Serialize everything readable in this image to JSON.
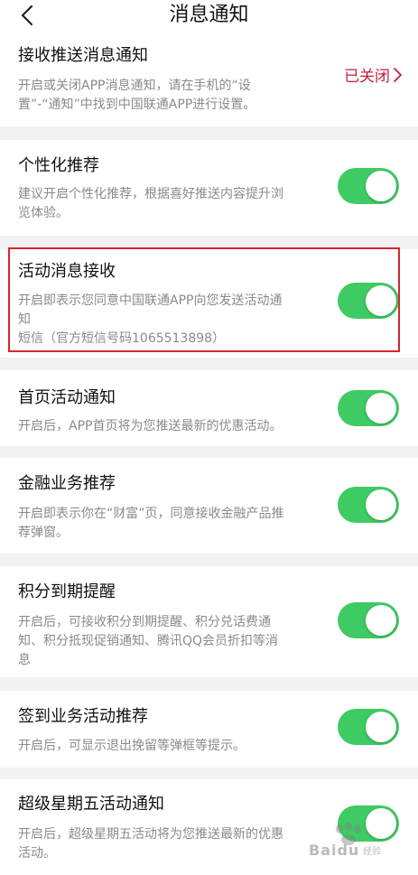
{
  "header": {
    "title": "消息通知"
  },
  "sections": [
    {
      "title": "接收推送消息通知",
      "desc": [
        "开启或关闭APP消息通知，请在手机的“设",
        "置”-“通知”中找到中国联通APP进行设置。"
      ],
      "status": "已关闭"
    },
    {
      "title": "个性化推荐",
      "desc": [
        "建议开启个性化推荐，根据喜好推送内容提升浏",
        "览体验。"
      ],
      "enabled": true
    },
    {
      "title": "活动消息接收",
      "desc": [
        "开启即表示您同意中国联通APP向您发送活动通",
        "知",
        "短信（官方短信号码1065513898）"
      ],
      "enabled": true
    },
    {
      "title": "首页活动通知",
      "desc": [
        "开启后，APP首页将为您推送最新的优惠活动。"
      ],
      "enabled": true
    },
    {
      "title": "金融业务推荐",
      "desc": [
        "开启即表示你在“财富”页，同意接收金融产品推",
        "荐弹窗。"
      ],
      "enabled": true
    },
    {
      "title": "积分到期提醒",
      "desc": [
        "开启后，可接收积分到期提醒、积分兑话费通",
        "知、积分抵现促销通知、腾讯QQ会员折扣等消",
        "息"
      ],
      "enabled": true
    },
    {
      "title": "签到业务活动推荐",
      "desc": [
        "开启后，可显示退出挽留等弹框等提示。"
      ],
      "enabled": true
    },
    {
      "title": "超级星期五活动通知",
      "desc": [
        "开启后，超级星期五活动将为您推送最新的优惠",
        "活动。"
      ],
      "enabled": true
    }
  ],
  "watermark": {
    "text": "Baidu",
    "sub": "经验"
  },
  "colors": {
    "toggle_on": "#3fcb63",
    "status": "#c3203c",
    "highlight": "#d9252b"
  }
}
